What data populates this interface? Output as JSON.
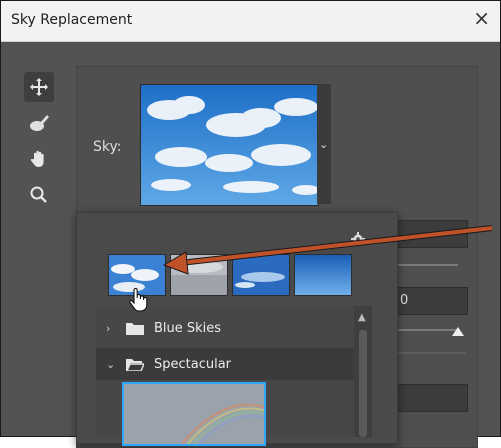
{
  "window": {
    "title": "Sky Replacement",
    "close_glyph": "×"
  },
  "tools": [
    {
      "icon": "move-icon",
      "active": true
    },
    {
      "icon": "sky-brush-icon",
      "active": false
    },
    {
      "icon": "hand-icon",
      "active": false
    },
    {
      "icon": "zoom-icon",
      "active": false
    }
  ],
  "sky": {
    "label": "Sky:",
    "dropdown_glyph": "⌄"
  },
  "folders": [
    {
      "label": "Blue Skies",
      "expanded": false,
      "chevron": "›"
    },
    {
      "label": "Spectacular",
      "expanded": true,
      "chevron": "⌄"
    }
  ],
  "right_panel": {
    "value_field": "0"
  },
  "colors": {
    "accent_arrow": "#c0522a",
    "selection": "#31a8ff"
  }
}
